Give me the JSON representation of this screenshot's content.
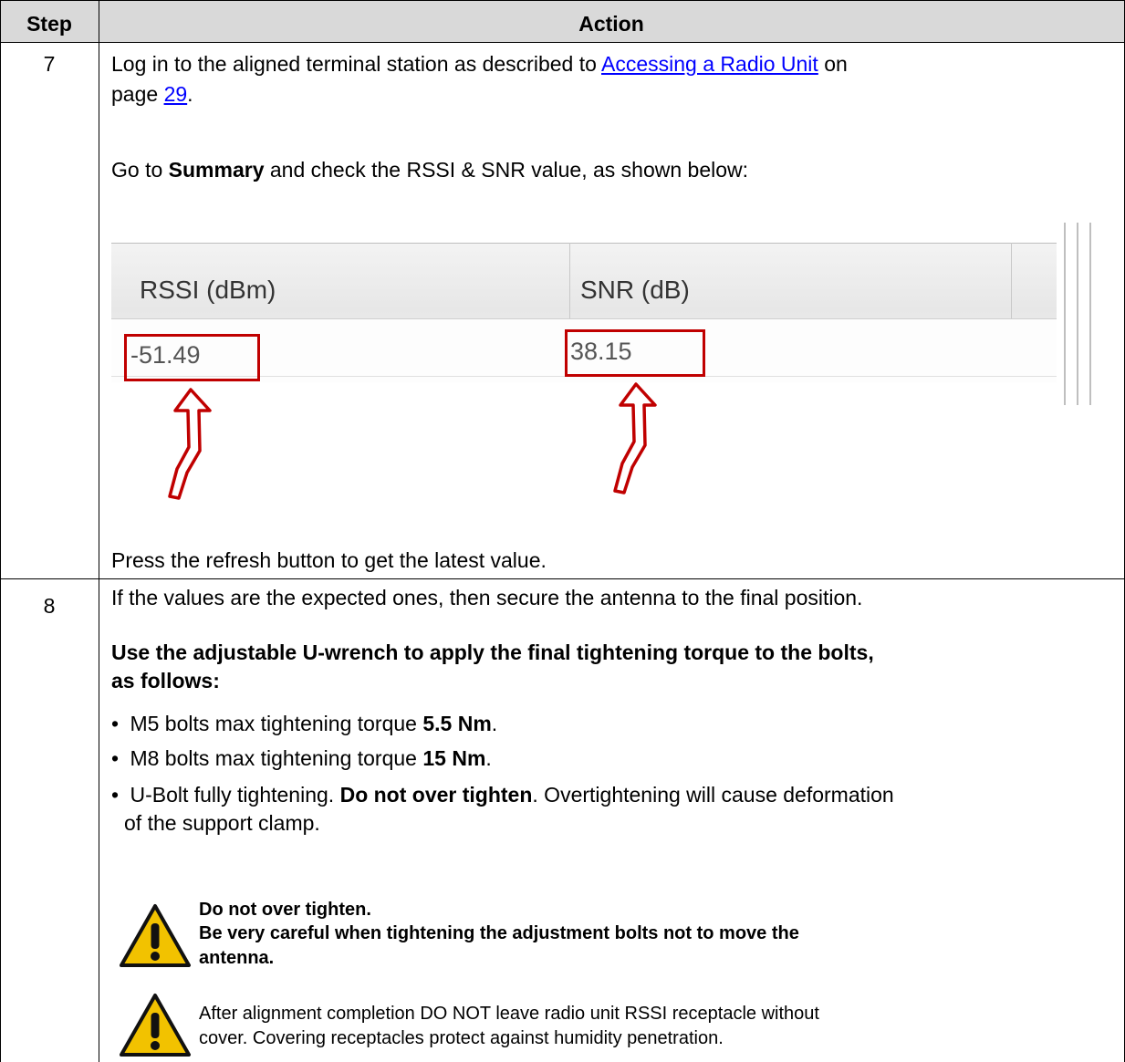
{
  "table": {
    "headers": {
      "step": "Step",
      "action": "Action"
    },
    "rows": [
      {
        "step": "7",
        "line1_a": "Log in to the aligned terminal station as described to ",
        "line1_link": "Accessing a Radio Unit",
        "line1_b": " on",
        "line2_a": "page ",
        "line2_link": "29",
        "line2_b": ".",
        "summary_a": "Go to ",
        "summary_b": "Summary",
        "summary_c": " and check the RSSI & SNR value, as shown below:",
        "screenshot": {
          "rssi_label": "RSSI (dBm)",
          "snr_label": "SNR (dB)",
          "rssi_value": "-51.49",
          "snr_value": "38.15",
          "highlight_color": "#c00000"
        },
        "refresh": "Press the refresh button to get the latest value."
      },
      {
        "step": "8",
        "intro": "If the values are the expected ones, then secure the antenna to the final position.",
        "bold_line1": "Use the adjustable U-wrench to apply the final tightening torque to the bolts,",
        "bold_line2": "as follows:",
        "bullets": [
          {
            "a": "M5 bolts max tightening torque ",
            "b": "5.5 Nm",
            "c": "."
          },
          {
            "a": "M8 bolts max tightening torque ",
            "b": "15 Nm",
            "c": "."
          },
          {
            "a": "U-Bolt fully tightening. ",
            "b": "Do not over tighten",
            "c": ". Overtightening will cause deformation",
            "cont": "of the support clamp."
          }
        ],
        "warnings": [
          {
            "line1": "Do not over tighten.",
            "line2": "Be very careful when tightening the adjustment bolts not to move the",
            "line3": "antenna."
          },
          {
            "line1": "After alignment completion DO NOT leave radio unit RSSI receptacle without",
            "line2": "cover. Covering receptacles protect against humidity penetration."
          }
        ],
        "warning_icon": "warning-triangle-icon",
        "warning_color": "#f2c200"
      }
    ]
  }
}
